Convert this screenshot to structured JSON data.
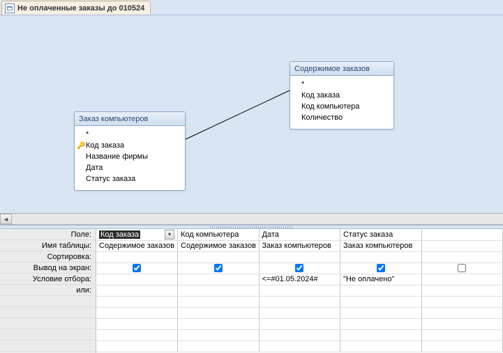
{
  "tab": {
    "title": "Не оплаченные заказы до 010524"
  },
  "tables": {
    "left": {
      "title": "Заказ компьютеров",
      "star": "*",
      "fields": [
        {
          "name": "Код заказа",
          "key": true
        },
        {
          "name": "Название фирмы",
          "key": false
        },
        {
          "name": "Дата",
          "key": false
        },
        {
          "name": "Статус заказа",
          "key": false
        }
      ]
    },
    "right": {
      "title": "Содержимое заказов",
      "star": "*",
      "fields": [
        {
          "name": "Код заказа",
          "key": false
        },
        {
          "name": "Код компьютера",
          "key": false
        },
        {
          "name": "Количество",
          "key": false
        }
      ]
    }
  },
  "gridLabels": {
    "field": "Поле:",
    "table": "Имя таблицы:",
    "sort": "Сортировка:",
    "show": "Вывод на экран:",
    "criteria": "Условие отбора:",
    "or": "или:"
  },
  "columns": [
    {
      "field": "Код заказа",
      "table": "Содержимое заказов",
      "sort": "",
      "show": true,
      "criteria": "",
      "selected": true
    },
    {
      "field": "Код компьютера",
      "table": "Содержимое заказов",
      "sort": "",
      "show": true,
      "criteria": ""
    },
    {
      "field": "Дата",
      "table": "Заказ компьютеров",
      "sort": "",
      "show": true,
      "criteria": "<=#01.05.2024#"
    },
    {
      "field": "Статус заказа",
      "table": "Заказ компьютеров",
      "sort": "",
      "show": true,
      "criteria": "\"Не оплачено\""
    },
    {
      "field": "",
      "table": "",
      "sort": "",
      "show": false,
      "criteria": ""
    }
  ]
}
